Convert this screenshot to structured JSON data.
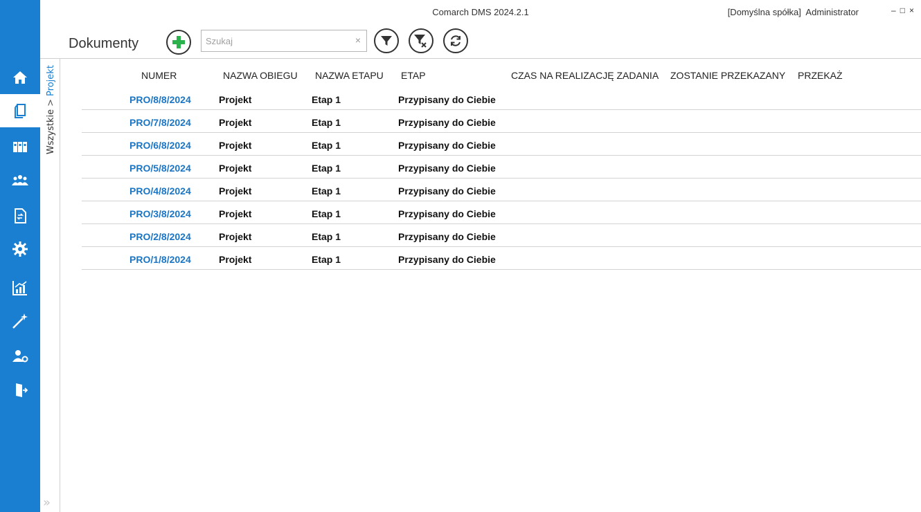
{
  "app": {
    "title": "Comarch DMS 2024.2.1",
    "company": "[Domyślna spółka]",
    "user": "Administrator"
  },
  "window_controls": {
    "minimize": "–",
    "maximize": "□",
    "close": "×"
  },
  "page": {
    "title": "Dokumenty"
  },
  "search": {
    "placeholder": "Szukaj",
    "value": "",
    "clear": "×"
  },
  "breadcrumb": {
    "all": "Wszystkie",
    "separator": ">",
    "current": "Projekt"
  },
  "expand_label": "»",
  "nav": [
    "home-icon",
    "documents-icon",
    "binders-icon",
    "users-icon",
    "document-flow-icon",
    "settings-icon",
    "reports-icon",
    "wizard-icon",
    "admin-icon",
    "logout-icon"
  ],
  "colors": {
    "accent": "#1a7fd0",
    "add": "#2bb24c",
    "link": "#1a75c4"
  },
  "table": {
    "columns": [
      "NUMER",
      "NAZWA OBIEGU",
      "NAZWA ETAPU",
      "ETAP",
      "CZAS NA REALIZACJĘ ZADANIA",
      "ZOSTANIE PRZEKAZANY",
      "PRZEKAŻ"
    ],
    "rows": [
      {
        "numer": "PRO/8/8/2024",
        "obieg": "Projekt",
        "etap_nazwa": "Etap 1",
        "etap": "Przypisany do Ciebie"
      },
      {
        "numer": "PRO/7/8/2024",
        "obieg": "Projekt",
        "etap_nazwa": "Etap 1",
        "etap": "Przypisany do Ciebie"
      },
      {
        "numer": "PRO/6/8/2024",
        "obieg": "Projekt",
        "etap_nazwa": "Etap 1",
        "etap": "Przypisany do Ciebie"
      },
      {
        "numer": "PRO/5/8/2024",
        "obieg": "Projekt",
        "etap_nazwa": "Etap 1",
        "etap": "Przypisany do Ciebie"
      },
      {
        "numer": "PRO/4/8/2024",
        "obieg": "Projekt",
        "etap_nazwa": "Etap 1",
        "etap": "Przypisany do Ciebie"
      },
      {
        "numer": "PRO/3/8/2024",
        "obieg": "Projekt",
        "etap_nazwa": "Etap 1",
        "etap": "Przypisany do Ciebie"
      },
      {
        "numer": "PRO/2/8/2024",
        "obieg": "Projekt",
        "etap_nazwa": "Etap 1",
        "etap": "Przypisany do Ciebie"
      },
      {
        "numer": "PRO/1/8/2024",
        "obieg": "Projekt",
        "etap_nazwa": "Etap 1",
        "etap": "Przypisany do Ciebie"
      }
    ]
  }
}
